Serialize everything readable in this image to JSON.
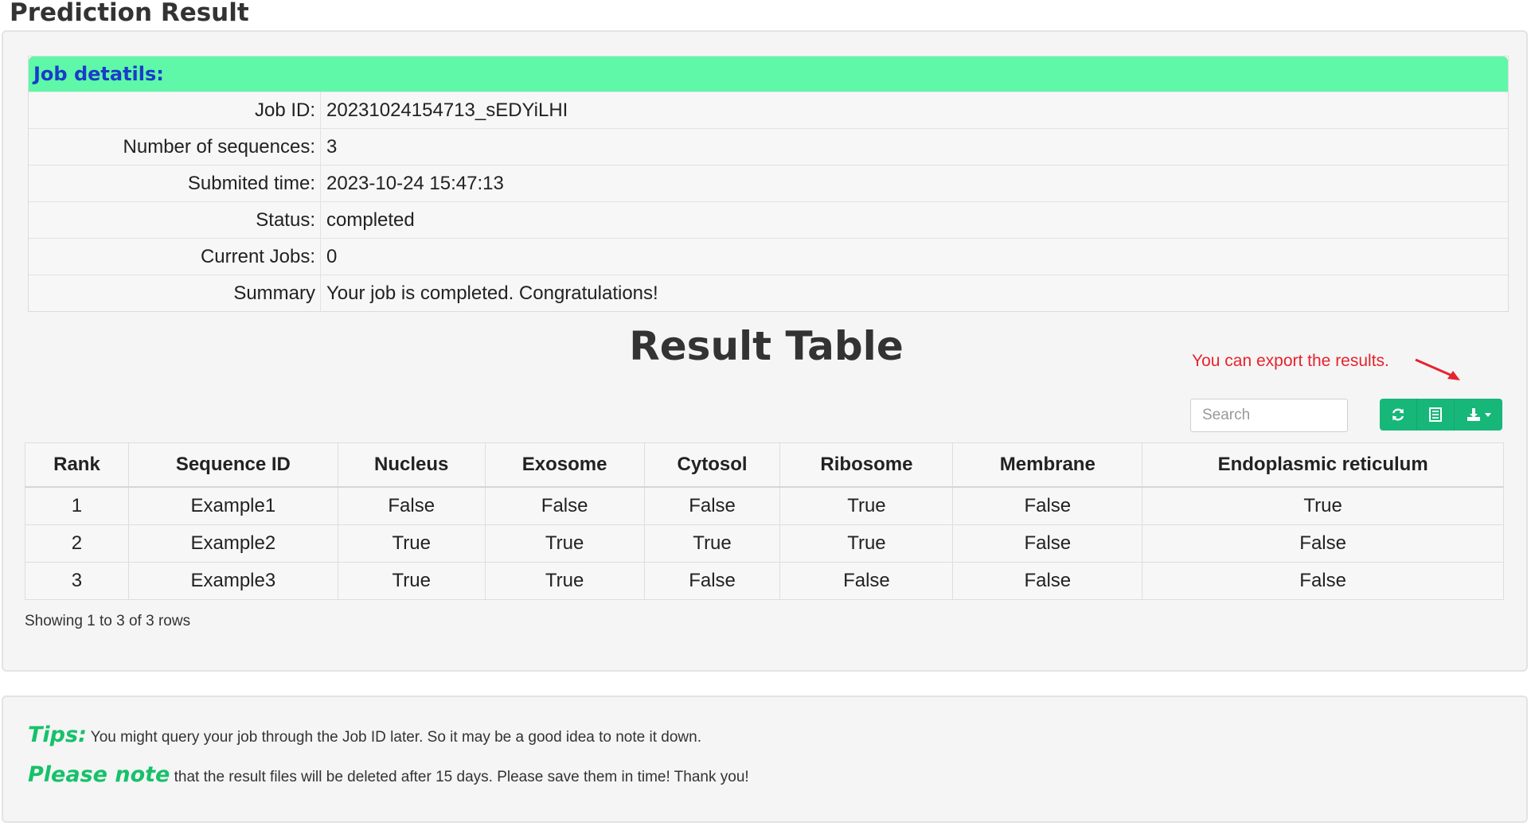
{
  "page": {
    "title": "Prediction Result"
  },
  "job": {
    "header": "Job detatils:",
    "rows": [
      {
        "label": "Job ID:",
        "value": "20231024154713_sEDYiLHI"
      },
      {
        "label": "Number of sequences:",
        "value": "3"
      },
      {
        "label": "Submited time:",
        "value": "2023-10-24 15:47:13"
      },
      {
        "label": "Status:",
        "value": "completed"
      },
      {
        "label": "Current Jobs:",
        "value": "0"
      },
      {
        "label": "Summary",
        "value": "Your job is completed. Congratulations!"
      }
    ]
  },
  "results": {
    "title": "Result Table",
    "export_hint": "You can export the results.",
    "search_placeholder": "Search",
    "toolbar": {
      "refresh_icon": "refresh-icon",
      "columns_icon": "columns-icon",
      "export_icon": "export-icon"
    },
    "columns": [
      "Rank",
      "Sequence ID",
      "Nucleus",
      "Exosome",
      "Cytosol",
      "Ribosome",
      "Membrane",
      "Endoplasmic reticulum"
    ],
    "rows": [
      [
        "1",
        "Example1",
        "False",
        "False",
        "False",
        "True",
        "False",
        "True"
      ],
      [
        "2",
        "Example2",
        "True",
        "True",
        "True",
        "True",
        "False",
        "False"
      ],
      [
        "3",
        "Example3",
        "True",
        "True",
        "False",
        "False",
        "False",
        "False"
      ]
    ],
    "pagination_text": "Showing 1 to 3 of 3 rows"
  },
  "tips": {
    "tips_key": "Tips:",
    "tips_text": " You might query your job through the Job ID later. So it may be a good idea to note it down.",
    "note_key": "Please note",
    "note_text": " that the result files will be deleted after 15 days. Please save them in time! Thank you!"
  },
  "colors": {
    "header_green": "#5ef8a8",
    "button_green": "#17b77a",
    "hint_red": "#e6232e",
    "tip_green": "#16c16a"
  }
}
